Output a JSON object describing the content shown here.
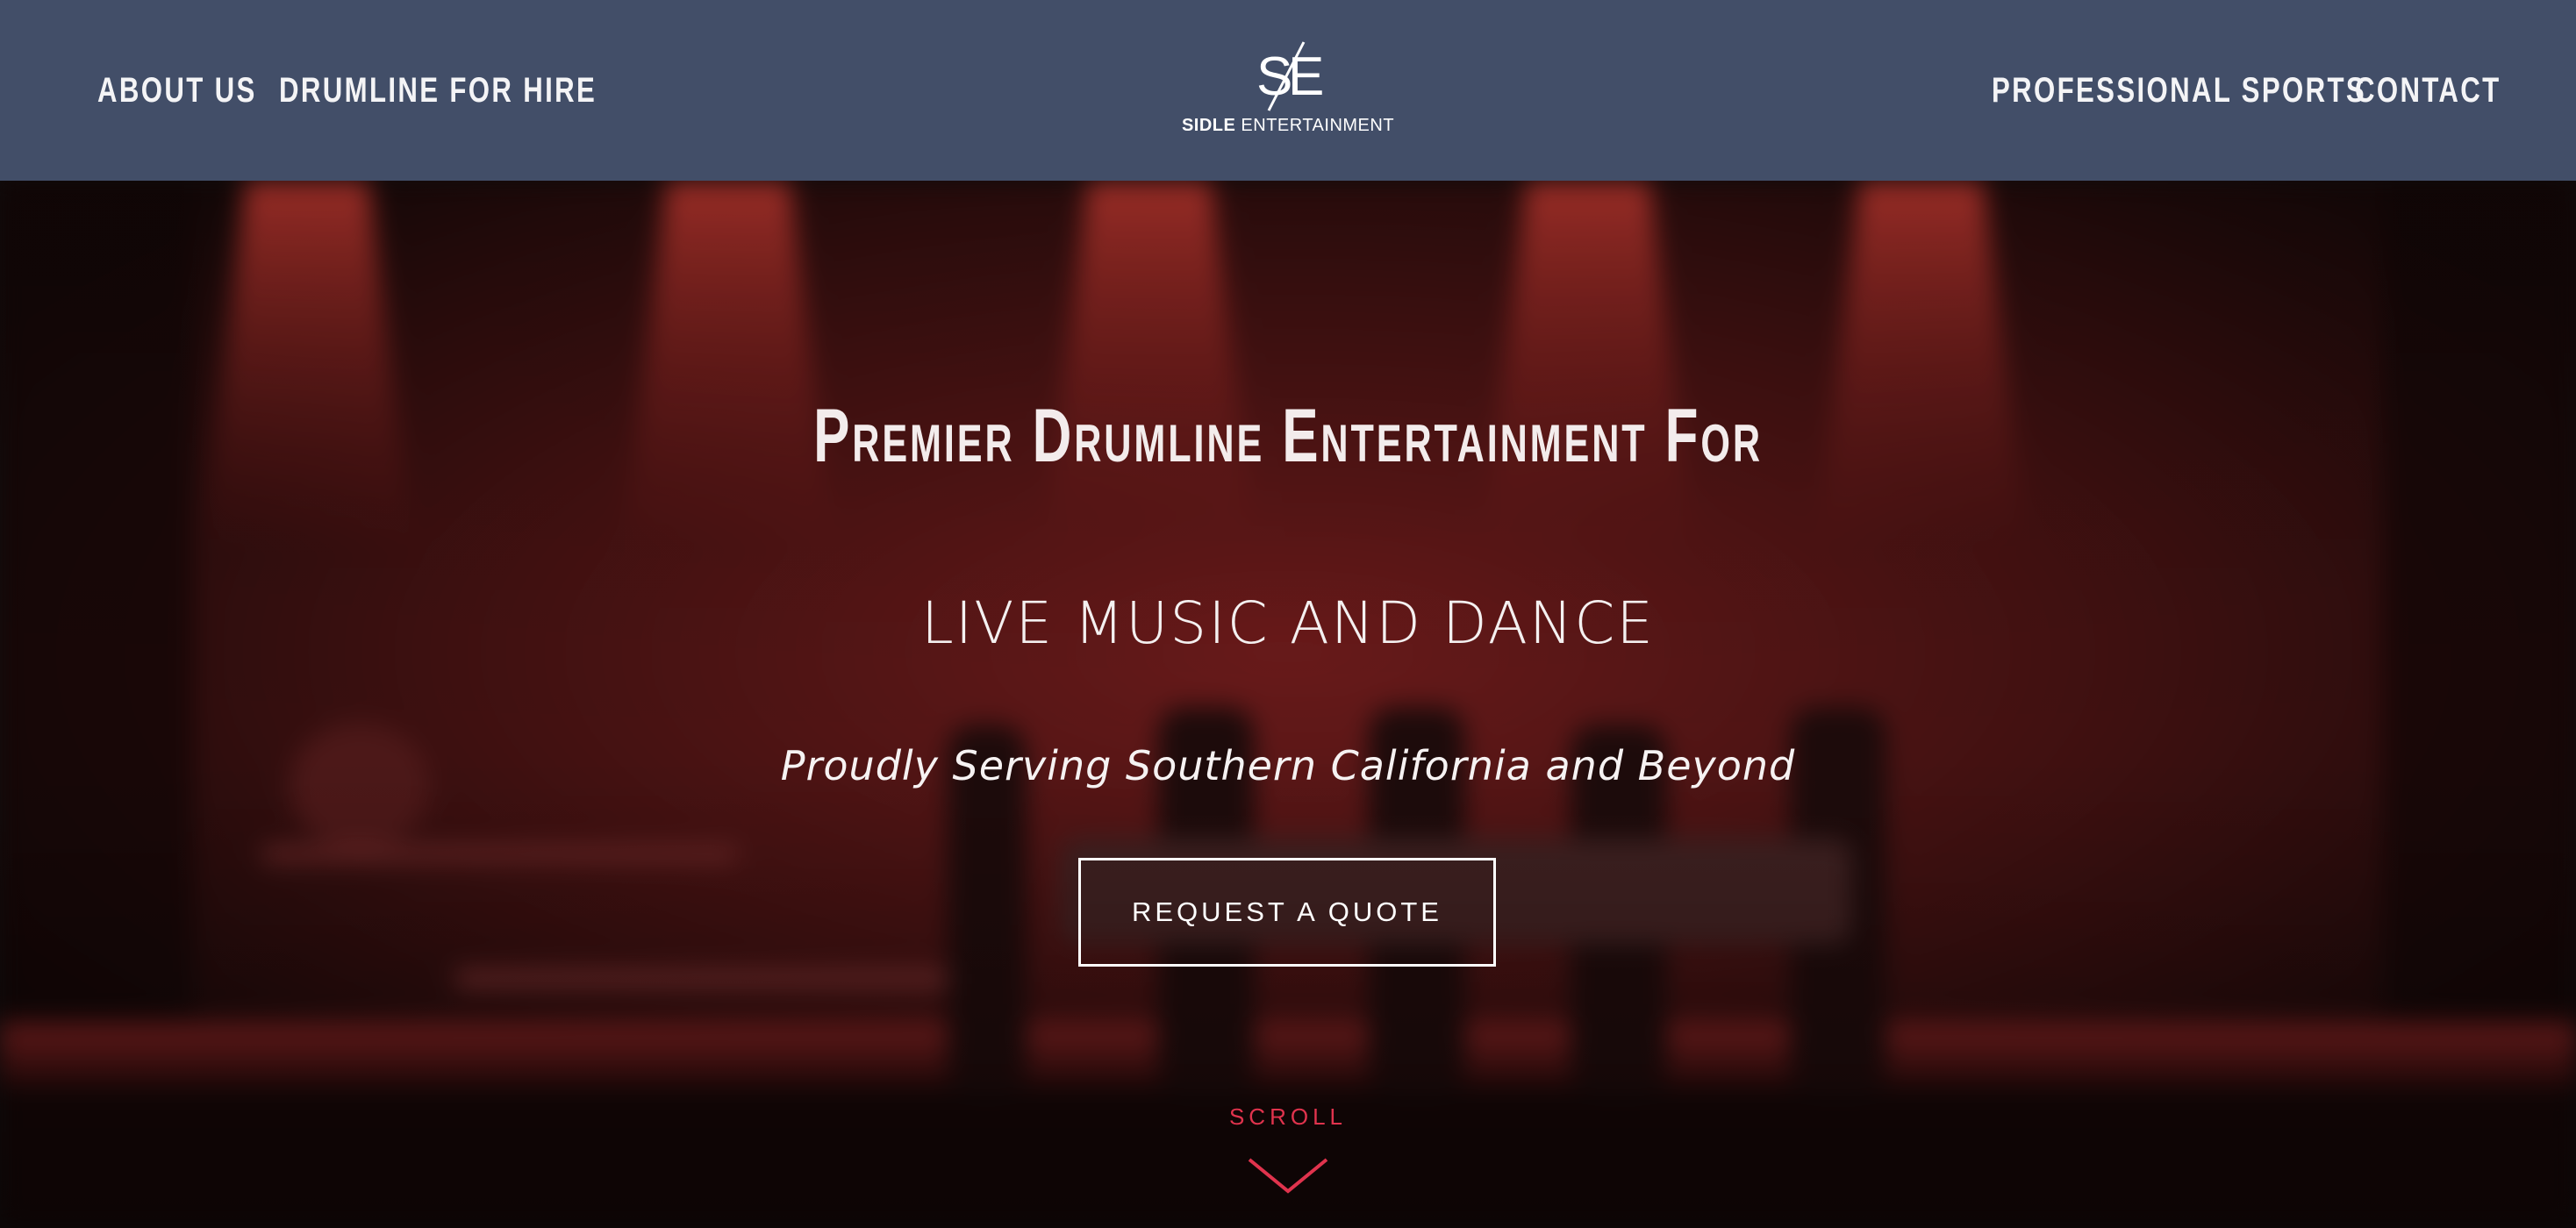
{
  "header": {
    "nav_left": [
      "ABOUT US",
      "DRUMLINE FOR HIRE"
    ],
    "nav_right": [
      "PROFESSIONAL SPORTS",
      "CONTACT"
    ],
    "logo": {
      "mark": "SE",
      "name_bold": "SIDLE",
      "name_rest": "ENTERTAINMENT"
    }
  },
  "hero": {
    "headline": "Premier Drumline Entertainment For",
    "subhead": "LIVE MUSIC AND DANCE",
    "tagline": "Proudly Serving Southern California and Beyond",
    "cta_label": "REQUEST A QUOTE",
    "scroll_label": "SCROLL",
    "scroll_icon": "chevron-down-icon"
  },
  "colors": {
    "header_bg": "#424e68",
    "accent": "#e0334d",
    "text": "#ffffff"
  }
}
